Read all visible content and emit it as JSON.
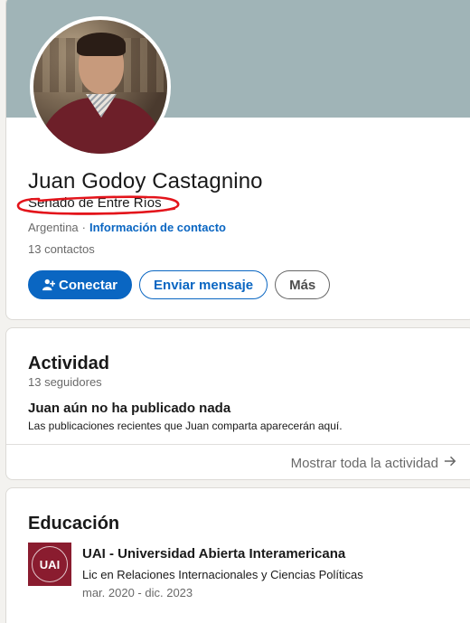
{
  "profile": {
    "name": "Juan Godoy Castagnino",
    "headline": "Senado de Entre Ríos",
    "location": "Argentina",
    "separator": "·",
    "contact_link": "Información de contacto",
    "connections": "13 contactos",
    "buttons": {
      "connect": "Conectar",
      "message": "Enviar mensaje",
      "more": "Más"
    },
    "icons": {
      "connect": "add-person-icon"
    },
    "colors": {
      "banner": "#a0b4b7",
      "accent": "#0a66c2",
      "annotation": "#e3141b"
    }
  },
  "activity": {
    "title": "Actividad",
    "followers": "13 seguidores",
    "empty_title": "Juan aún no ha publicado nada",
    "empty_description": "Las publicaciones recientes que Juan comparta aparecerán aquí.",
    "show_all": "Mostrar toda la actividad",
    "show_all_icon": "arrow-right-icon"
  },
  "education": {
    "title": "Educación",
    "logo_text": "UAI",
    "school": "UAI - Universidad Abierta Interamericana",
    "degree": "Lic en Relaciones Internacionales y Ciencias Políticas",
    "dates": "mar. 2020 - dic. 2023",
    "colors": {
      "logo": "#8a1c2f"
    }
  }
}
